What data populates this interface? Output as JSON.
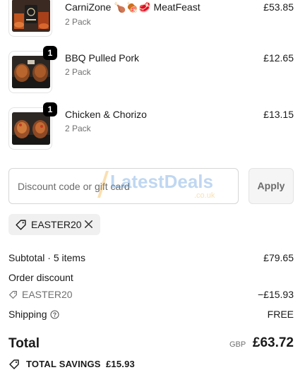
{
  "cart": {
    "items": [
      {
        "name": "CarniZone 🍗🍖🥩 MeatFeast",
        "variant": "2 Pack",
        "price": "£53.85",
        "quantity": "",
        "image_icon": "meat-box-image-icon"
      },
      {
        "name": "BBQ Pulled Pork",
        "variant": "2 Pack",
        "price": "£12.65",
        "quantity": "1",
        "image_icon": "pulled-pork-image-icon"
      },
      {
        "name": "Chicken & Chorizo",
        "variant": "2 Pack",
        "price": "£13.15",
        "quantity": "1",
        "image_icon": "chicken-chorizo-image-icon"
      }
    ]
  },
  "discount": {
    "placeholder": "Discount code or gift card",
    "value": "",
    "apply_label": "Apply",
    "applied_code": "EASTER20"
  },
  "watermark": {
    "main": "LatestDeals",
    "sub": ".co.uk"
  },
  "summary": {
    "subtotal_label": "Subtotal · 5 items",
    "subtotal_value": "£79.65",
    "order_discount_label": "Order discount",
    "discount_code": "EASTER20",
    "discount_value": "−£15.93",
    "shipping_label": "Shipping",
    "shipping_value": "FREE",
    "total_label": "Total",
    "currency": "GBP",
    "total_value": "£63.72",
    "savings_label": "TOTAL SAVINGS",
    "savings_value": "£15.93"
  },
  "colors": {
    "badge": "#000000",
    "chip_bg": "#f0f0f0",
    "muted_text": "#707070",
    "watermark_blue": "#4a90d9",
    "watermark_orange": "#f5a623"
  }
}
